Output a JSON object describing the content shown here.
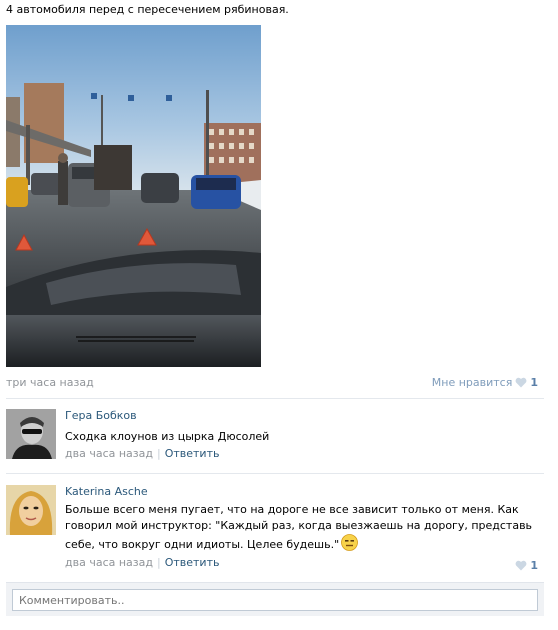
{
  "post": {
    "text": "4 автомобиля перед с пересечением рябиновая.",
    "time": "три часа назад",
    "like_label": "Мне нравится",
    "like_count": "1"
  },
  "comments": [
    {
      "author": "Гера Бобков",
      "text": "Сходка клоунов из цырка Дюсолей",
      "time": "два часа назад",
      "reply_label": "Ответить"
    },
    {
      "author": "Katerina Asche",
      "text": "Больше всего меня пугает, что на дороге не все зависит только от меня. Как говорил мой инструктор: \"Каждый раз, когда выезжаешь на дорогу, представь себе, что вокруг одни идиоты. Целее будешь.\"",
      "time": "два часа назад",
      "reply_label": "Ответить",
      "like_count": "1"
    }
  ],
  "reply_box": {
    "placeholder": "Комментировать.."
  },
  "icons": {
    "like": "heart-icon",
    "smiley": "smiley-icon"
  }
}
